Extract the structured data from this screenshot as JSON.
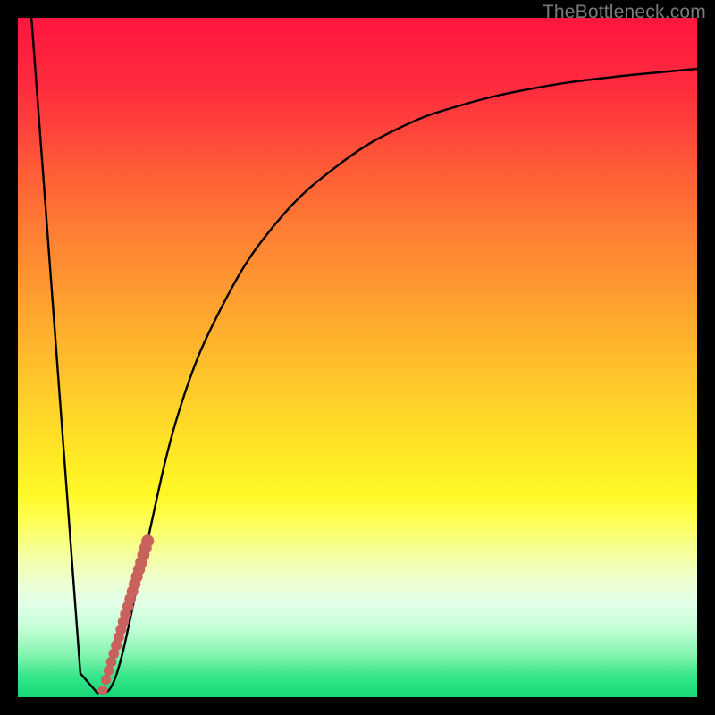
{
  "watermark": "TheBottleneck.com",
  "colors": {
    "frame": "#000000",
    "curve": "#000000",
    "marker": "#c9615d"
  },
  "chart_data": {
    "type": "line",
    "title": "",
    "xlabel": "",
    "ylabel": "",
    "xlim": [
      0,
      100
    ],
    "ylim": [
      0,
      100
    ],
    "grid": false,
    "series": [
      {
        "name": "bottleneck-curve",
        "x": [
          2,
          9.2,
          11.8,
          14.5,
          18.4,
          23.7,
          30.3,
          38.2,
          47.4,
          56.6,
          65.8,
          76.3,
          86.8,
          100
        ],
        "y": [
          100,
          3.5,
          0.5,
          3.3,
          20,
          42,
          58,
          70,
          78.5,
          84,
          87.3,
          89.7,
          91.2,
          92.5
        ]
      }
    ],
    "markers": {
      "name": "highlight-dots",
      "x_range": [
        12.5,
        19.1
      ],
      "y_range": [
        1.0,
        23.0
      ],
      "count": 20
    }
  }
}
